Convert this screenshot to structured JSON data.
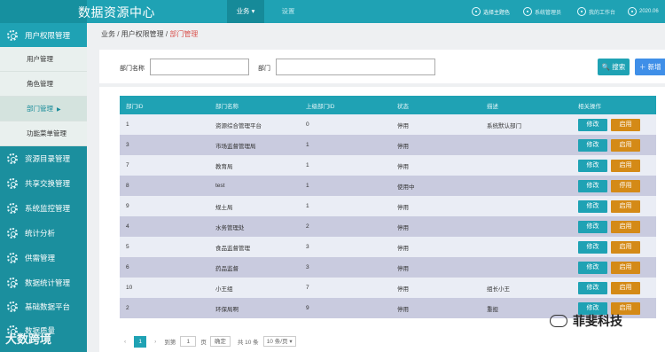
{
  "header": {
    "title": "数据资源中心",
    "nav": [
      {
        "label": "业务 ▾"
      },
      {
        "label": "设置"
      }
    ],
    "right_items": [
      {
        "label": "选择主题色",
        "icon": "palette-icon"
      },
      {
        "label": "系统管理员",
        "icon": "user-icon"
      },
      {
        "label": "我的工作台",
        "icon": "desk-icon"
      },
      {
        "label": "2020.06",
        "icon": "clock-icon"
      }
    ]
  },
  "sidebar": {
    "items": [
      {
        "label": "用户权限管理"
      },
      {
        "label": "资源目录管理"
      },
      {
        "label": "共享交换管理"
      },
      {
        "label": "系统监控管理"
      },
      {
        "label": "统计分析"
      },
      {
        "label": "供需管理"
      },
      {
        "label": "数据统计管理"
      },
      {
        "label": "基础数据平台"
      },
      {
        "label": "数据质量"
      }
    ],
    "sub_items": [
      {
        "label": "用户管理"
      },
      {
        "label": "角色管理"
      },
      {
        "label": "部门管理",
        "arrow": "▶"
      },
      {
        "label": "功能菜单管理"
      }
    ]
  },
  "breadcrumb": {
    "part1": "业务 / 用户权限管理 / ",
    "current": "部门管理"
  },
  "search": {
    "dept_name_label": "部门名称",
    "dept_label": "部门",
    "search_button": "🔍 搜索",
    "add_button": "＋ 新增"
  },
  "table": {
    "headers": [
      "部门ID",
      "部门名称",
      "上级部门ID",
      "状态",
      "描述",
      "相关操作"
    ],
    "rows": [
      {
        "id": "1",
        "name": "资源综合管理平台",
        "parent": "0",
        "status": "停用",
        "desc": "系统默认部门",
        "edit": "修改",
        "toggle": "启用"
      },
      {
        "id": "3",
        "name": "市场监督管理局",
        "parent": "1",
        "status": "停用",
        "desc": "",
        "edit": "修改",
        "toggle": "启用"
      },
      {
        "id": "7",
        "name": "教育局",
        "parent": "1",
        "status": "停用",
        "desc": "",
        "edit": "修改",
        "toggle": "启用"
      },
      {
        "id": "8",
        "name": "test",
        "parent": "1",
        "status": "使用中",
        "desc": "",
        "edit": "修改",
        "toggle": "停用"
      },
      {
        "id": "9",
        "name": "规土局",
        "parent": "1",
        "status": "停用",
        "desc": "",
        "edit": "修改",
        "toggle": "启用"
      },
      {
        "id": "4",
        "name": "水务管理处",
        "parent": "2",
        "status": "停用",
        "desc": "",
        "edit": "修改",
        "toggle": "启用"
      },
      {
        "id": "5",
        "name": "食品监督管理",
        "parent": "3",
        "status": "停用",
        "desc": "",
        "edit": "修改",
        "toggle": "启用"
      },
      {
        "id": "6",
        "name": "药品监督",
        "parent": "3",
        "status": "停用",
        "desc": "",
        "edit": "修改",
        "toggle": "启用"
      },
      {
        "id": "10",
        "name": "小王组",
        "parent": "7",
        "status": "停用",
        "desc": "组长小王",
        "edit": "修改",
        "toggle": "启用"
      },
      {
        "id": "2",
        "name": "环保局啊",
        "parent": "9",
        "status": "停用",
        "desc": "重担",
        "edit": "修改",
        "toggle": "启用"
      }
    ]
  },
  "pager": {
    "prev": "‹",
    "page": "1",
    "next": "›",
    "goto": "到第",
    "goto_value": "1",
    "page_unit": "页",
    "confirm": "确定",
    "total": "共 10 条",
    "size": "10 条/页 ▾"
  },
  "watermarks": {
    "left": "大数跨境",
    "right": "菲斐科技"
  },
  "colors": {
    "primary": "#1fa2b4",
    "sidebar": "#1b8f9e",
    "toggle": "#d48a17",
    "add": "#3f8fe8",
    "row_even": "#c9cbdf",
    "row_odd": "#eaedf5"
  }
}
